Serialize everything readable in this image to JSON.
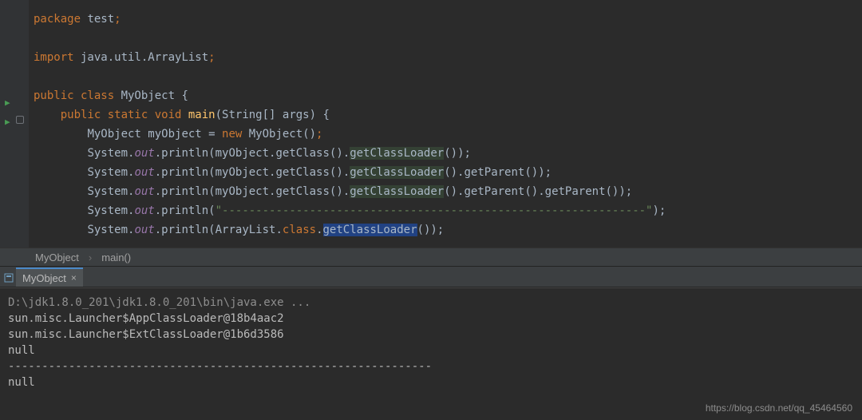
{
  "code": {
    "l1_kw1": "package",
    "l1_id": " test",
    "l1_semi": ";",
    "l3_kw1": "import",
    "l3_pkg": " java.util.ArrayList",
    "l3_semi": ";",
    "l5_kw1": "public class ",
    "l5_cls": "MyObject",
    "l5_open": " {",
    "l6_indent": "    ",
    "l6_kw": "public static void ",
    "l6_fn": "main",
    "l6_sig_open": "(",
    "l6_sig": "String[] args",
    "l6_sig_close": ") {",
    "l7_indent": "        ",
    "l7_cls": "MyObject myObject = ",
    "l7_new": "new ",
    "l7_ctor": "MyObject()",
    "l7_semi": ";",
    "sys": "System.",
    "out": "out",
    "println_open": ".println(",
    "l8_arg1": "myObject.getClass().",
    "gcl": "getClassLoader",
    "paren_close": "()",
    "l8_end": ");",
    "l9_arg1": "myObject.getClass().",
    "l9_mid": "().getParent()",
    "l9_end": ");",
    "l10_arg1": "myObject.getClass().",
    "l10_mid": "().getParent().getParent()",
    "l10_end": ");",
    "l11_str": "\"---------------------------------------------------------------\"",
    "l11_end": ");",
    "l12_arg1": "ArrayList.",
    "l12_cls": "class",
    "l12_dot": ".",
    "l12_end": "());"
  },
  "breadcrumb": {
    "item1": "MyObject",
    "item2": "main()"
  },
  "console_tab": {
    "label": "MyObject"
  },
  "console": {
    "line1": "D:\\jdk1.8.0_201\\jdk1.8.0_201\\bin\\java.exe ...",
    "line2": "sun.misc.Launcher$AppClassLoader@18b4aac2",
    "line3": "sun.misc.Launcher$ExtClassLoader@1b6d3586",
    "line4": "null",
    "line5": "---------------------------------------------------------------",
    "line6": "null"
  },
  "watermark": "https://blog.csdn.net/qq_45464560"
}
